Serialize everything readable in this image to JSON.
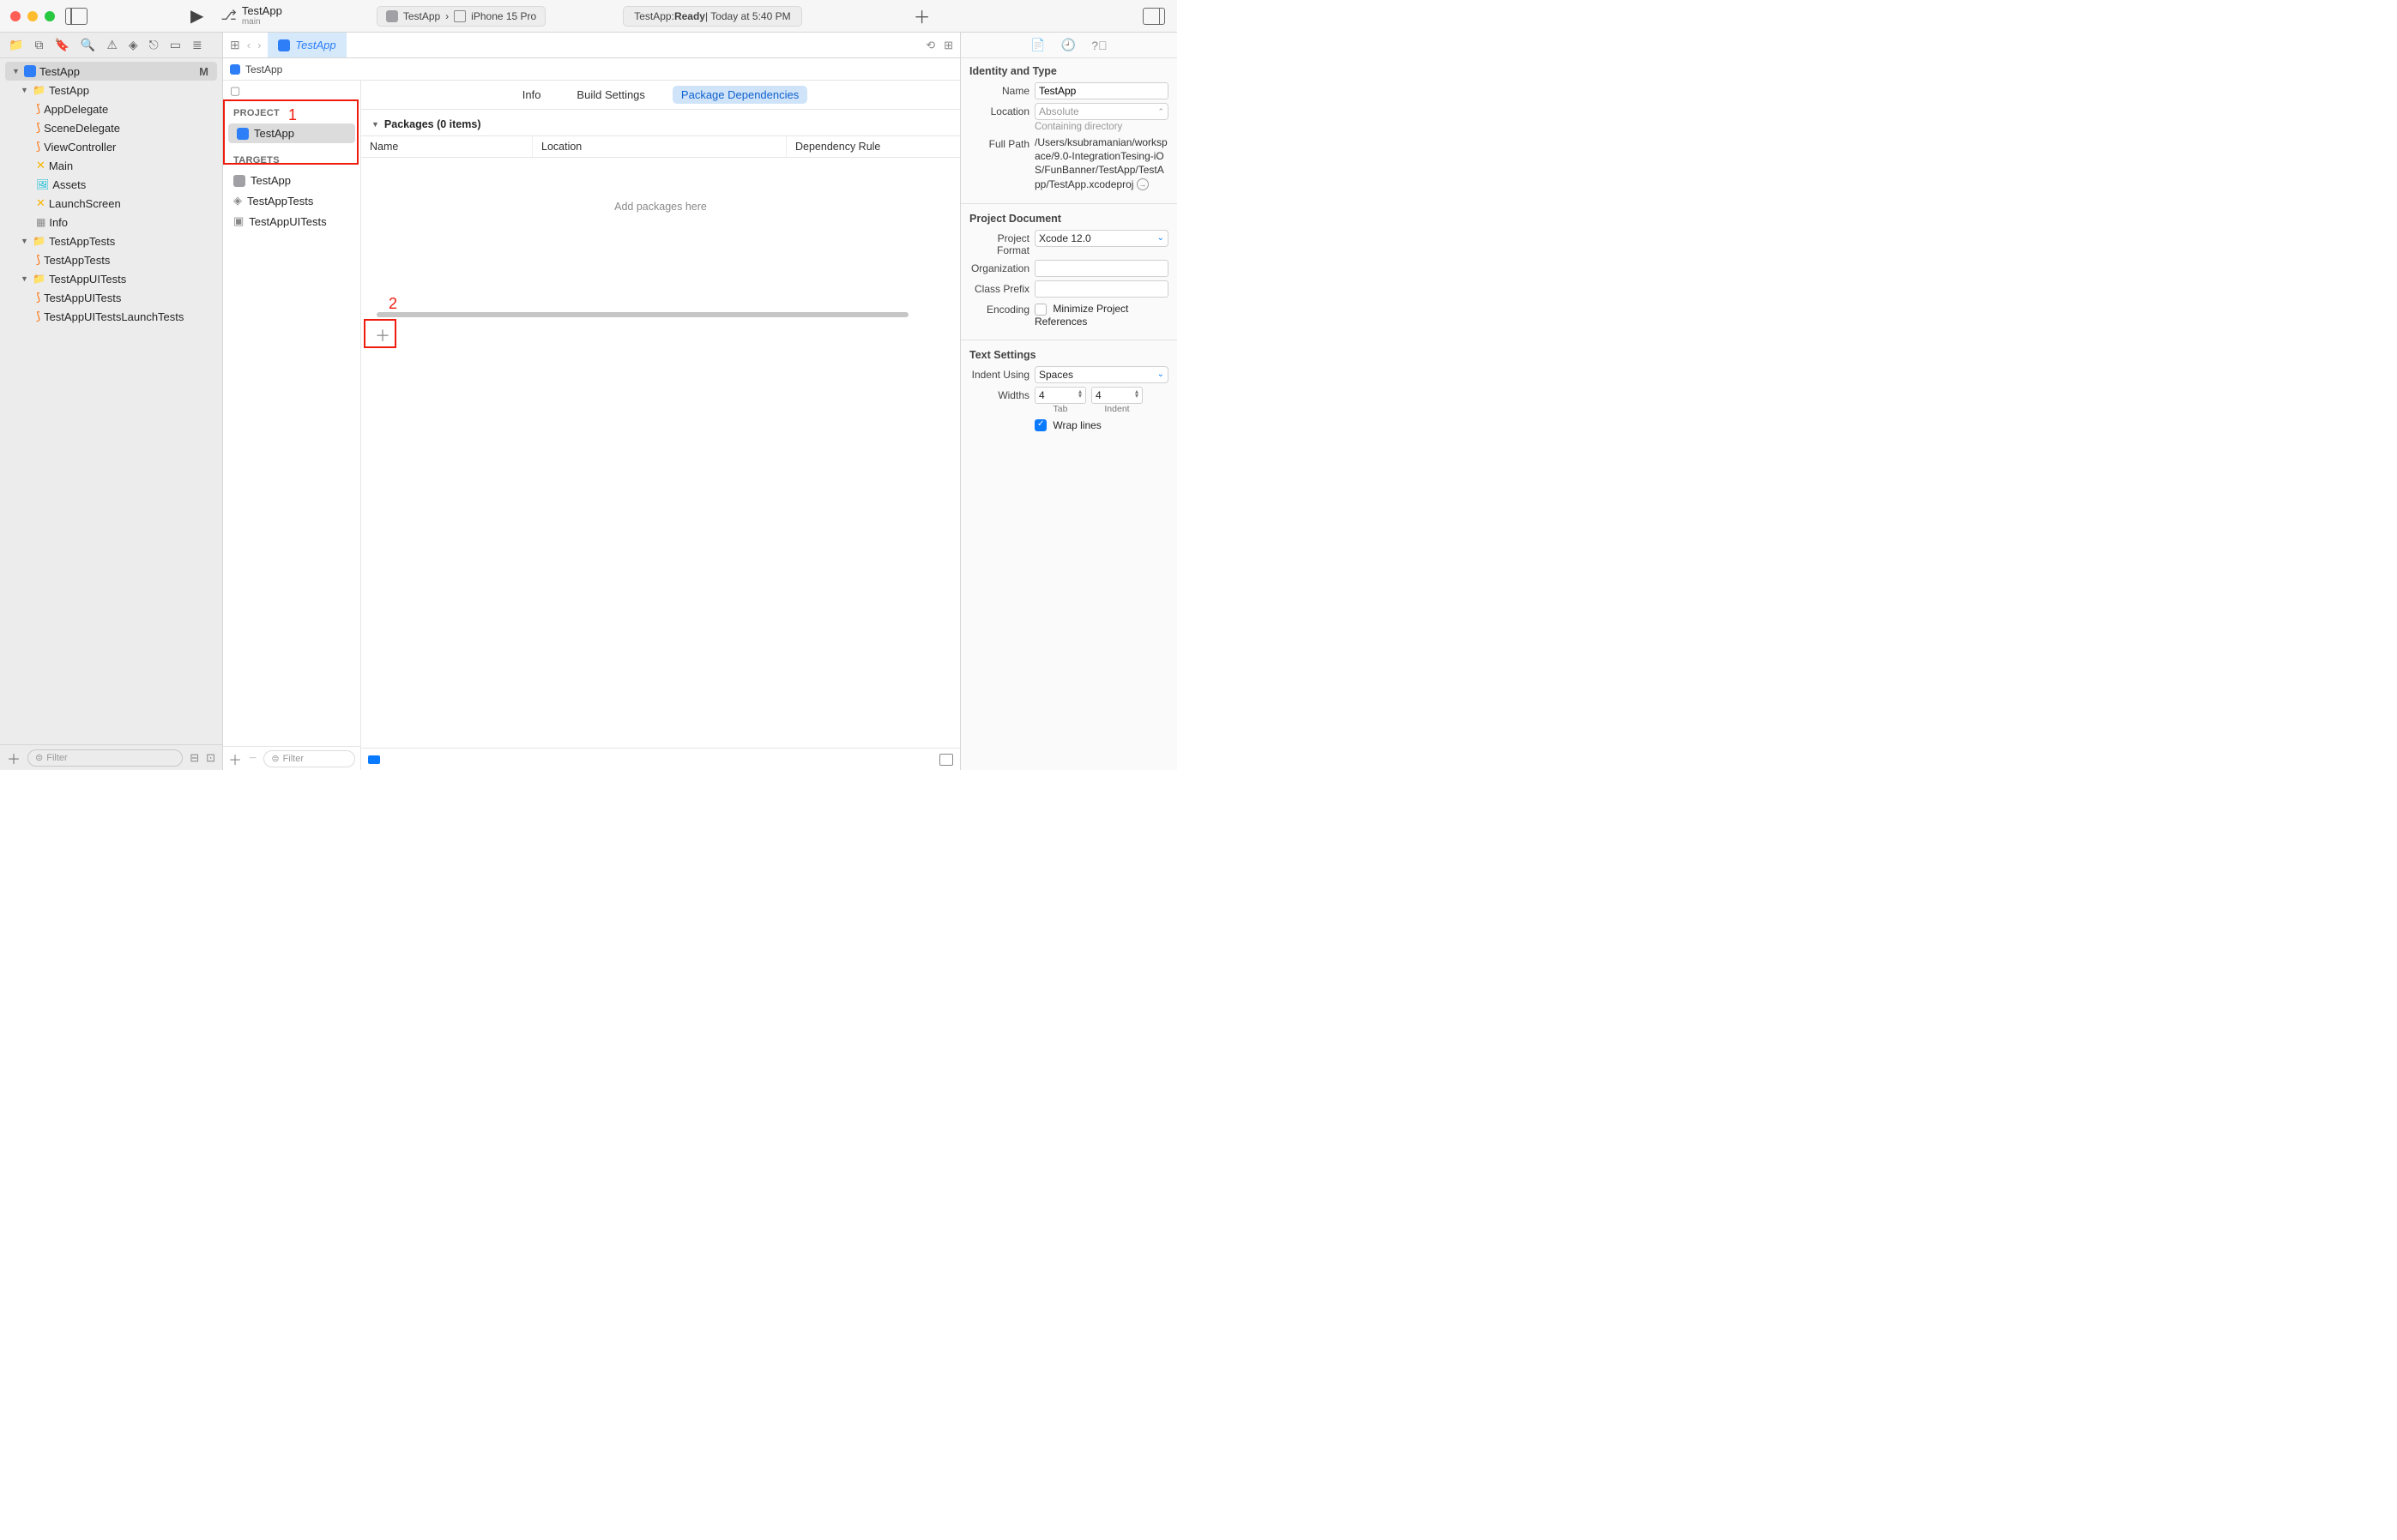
{
  "titlebar": {
    "project_name": "TestApp",
    "branch": "main",
    "scheme": "TestApp",
    "device": "iPhone 15 Pro",
    "status_prefix": "TestApp: ",
    "status_state": "Ready",
    "status_time": " | Today at 5:40 PM"
  },
  "sidebar": {
    "root": "TestApp",
    "root_badge": "M",
    "groups": [
      {
        "name": "TestApp",
        "children": [
          "AppDelegate",
          "SceneDelegate",
          "ViewController",
          "Main",
          "Assets",
          "LaunchScreen",
          "Info"
        ]
      },
      {
        "name": "TestAppTests",
        "children": [
          "TestAppTests"
        ]
      },
      {
        "name": "TestAppUITests",
        "children": [
          "TestAppUITests",
          "TestAppUITestsLaunchTests"
        ]
      }
    ],
    "filter_placeholder": "Filter"
  },
  "tabbar": {
    "active_tab": "TestApp"
  },
  "breadcrumb": {
    "item": "TestApp"
  },
  "project_list": {
    "project_header": "PROJECT",
    "project_item": "TestApp",
    "targets_header": "TARGETS",
    "targets": [
      "TestApp",
      "TestAppTests",
      "TestAppUITests"
    ],
    "filter_placeholder": "Filter"
  },
  "annotations": {
    "one": "1",
    "two": "2"
  },
  "detail_tabs": [
    "Info",
    "Build Settings",
    "Package Dependencies"
  ],
  "packages": {
    "header": "Packages (0 items)",
    "columns": [
      "Name",
      "Location",
      "Dependency Rule"
    ],
    "empty": "Add packages here"
  },
  "inspector": {
    "identity_header": "Identity and Type",
    "name_label": "Name",
    "name_value": "TestApp",
    "location_label": "Location",
    "location_value": "Absolute",
    "containing_dir": "Containing directory",
    "fullpath_label": "Full Path",
    "fullpath_value": "/Users/ksubramanian/workspace/9.0-IntegrationTesing-iOS/FunBanner/TestApp/TestApp/TestApp.xcodeproj",
    "projdoc_header": "Project Document",
    "format_label": "Project Format",
    "format_value": "Xcode 12.0",
    "org_label": "Organization",
    "prefix_label": "Class Prefix",
    "encoding_label": "Encoding",
    "minimize_label": "Minimize Project References",
    "text_header": "Text Settings",
    "indent_label": "Indent Using",
    "indent_value": "Spaces",
    "widths_label": "Widths",
    "tab_width": "4",
    "indent_width": "4",
    "tab_sub": "Tab",
    "indent_sub": "Indent",
    "wrap_label": "Wrap lines"
  }
}
